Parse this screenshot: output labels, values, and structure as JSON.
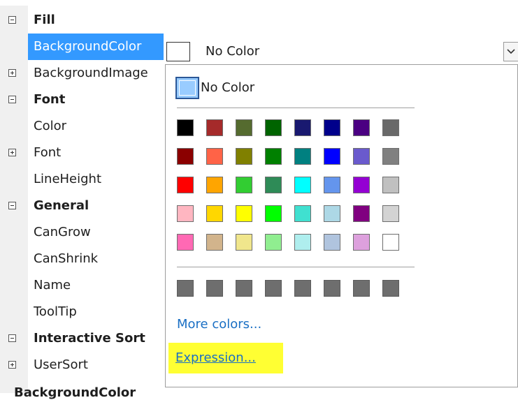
{
  "property_grid": {
    "rows": [
      {
        "label": "Fill",
        "kind": "category",
        "expander": "minus"
      },
      {
        "label": "BackgroundColor",
        "kind": "property",
        "selected": true
      },
      {
        "label": "BackgroundImage",
        "kind": "property",
        "expander": "plus"
      },
      {
        "label": "Font",
        "kind": "category",
        "expander": "minus"
      },
      {
        "label": "Color",
        "kind": "property"
      },
      {
        "label": "Font",
        "kind": "property",
        "expander": "plus"
      },
      {
        "label": "LineHeight",
        "kind": "property"
      },
      {
        "label": "General",
        "kind": "category",
        "expander": "minus"
      },
      {
        "label": "CanGrow",
        "kind": "property"
      },
      {
        "label": "CanShrink",
        "kind": "property"
      },
      {
        "label": "Name",
        "kind": "property"
      },
      {
        "label": "ToolTip",
        "kind": "property"
      },
      {
        "label": "Interactive Sort",
        "kind": "category",
        "expander": "minus"
      },
      {
        "label": "UserSort",
        "kind": "property",
        "expander": "plus"
      }
    ],
    "selected_value": "No Color",
    "dropdown_icon": "chevron-down-icon",
    "description_title": "BackgroundColor"
  },
  "color_popup": {
    "no_color_label": "No Color",
    "palette": [
      [
        "#000000",
        "#a52a2a",
        "#556b2f",
        "#006400",
        "#191970",
        "#00008b",
        "#4b0082",
        "#696969"
      ],
      [
        "#8b0000",
        "#ff6347",
        "#808000",
        "#008000",
        "#008080",
        "#0000ff",
        "#6a5acd",
        "#808080"
      ],
      [
        "#ff0000",
        "#ffa500",
        "#32cd32",
        "#2e8b57",
        "#00ffff",
        "#6495ed",
        "#9400d3",
        "#c0c0c0"
      ],
      [
        "#ffb6c1",
        "#ffd700",
        "#ffff00",
        "#00ff00",
        "#40e0d0",
        "#add8e6",
        "#800080",
        "#d3d3d3"
      ],
      [
        "#ff69b4",
        "#d2b48c",
        "#f0e68c",
        "#90ee90",
        "#afeeee",
        "#b0c4de",
        "#dda0dd",
        "#ffffff"
      ]
    ],
    "custom_colors_count": 8,
    "more_colors_label": "More colors...",
    "expression_label": "Expression...",
    "highlight_color": "#ffff33",
    "link_color": "#1a6fc4"
  }
}
